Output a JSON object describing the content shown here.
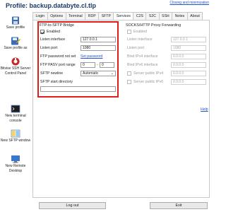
{
  "window": {
    "title": "Profile: backup.databyte.cl.tlp",
    "closing_link": "Closing and minimization"
  },
  "sidebar": {
    "items": [
      {
        "label": "Save profile",
        "icon": "floppy-disk-icon"
      },
      {
        "label": "Save profile as",
        "icon": "save-as-icon"
      },
      {
        "label": "Bitvise SSH Server Control Panel",
        "icon": "server-control-panel-icon"
      },
      {
        "label": "New terminal console",
        "icon": "terminal-console-icon"
      },
      {
        "label": "New SFTP window",
        "icon": "sftp-window-icon"
      },
      {
        "label": "New Remote Desktop",
        "icon": "remote-desktop-icon"
      }
    ]
  },
  "tabs": [
    {
      "label": "Login"
    },
    {
      "label": "Options"
    },
    {
      "label": "Terminal"
    },
    {
      "label": "RDP"
    },
    {
      "label": "SFTP"
    },
    {
      "label": "Services",
      "active": true
    },
    {
      "label": "C2S"
    },
    {
      "label": "S2C"
    },
    {
      "label": "SSH"
    },
    {
      "label": "Notes"
    },
    {
      "label": "About"
    }
  ],
  "ftp_bridge": {
    "title": "FTP-to-SFTP Bridge",
    "enabled_label": "Enabled",
    "enabled": true,
    "listen_interface_label": "Listen interface",
    "listen_interface_value": "127.0.0.1",
    "listen_port_label": "Listen port",
    "listen_port_value": "1080",
    "password_label": "FTP password not set",
    "set_password_link": "Set password",
    "pasv_label": "FTP PASV port range",
    "pasv_from": "0",
    "pasv_to": "0",
    "newline_label": "SFTP newline",
    "newline_value": "Automatic",
    "start_dir_label": "SFTP start directory",
    "start_dir_value": ""
  },
  "socks_proxy": {
    "title": "SOCKS/HTTP Proxy Forwarding",
    "enabled_label": "Enabled",
    "enabled": false,
    "listen_interface_label": "Listen Interface",
    "listen_interface_value": "127.0.0.1",
    "listen_port_label": "Listen port",
    "listen_port_value": "1080",
    "bind_ipv4_label": "Bind IPv4 interface",
    "bind_ipv4_value": "0.0.0.0",
    "bind_ipv6_label": "Bind IPv6 interface",
    "bind_ipv6_value": "0.0.0.0",
    "server_ipv4_label": "Server public IPv4",
    "server_ipv4_value": "0.0.0.0",
    "server_ipv6_label": "Server public IPv6",
    "server_ipv6_value": "0.0.0.0"
  },
  "help_link": "Help",
  "buttons": {
    "logout": "Log out",
    "exit": "Exit"
  },
  "colors": {
    "highlight_border": "#e11d1d",
    "link": "#2255cc",
    "title": "#1a3a6a"
  }
}
